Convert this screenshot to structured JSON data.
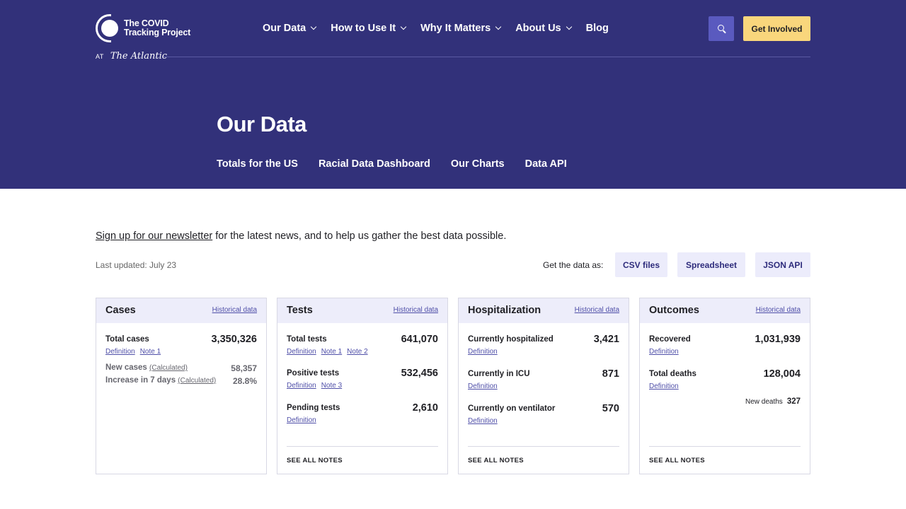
{
  "brand": {
    "name_line1": "The COVID",
    "name_line2": "Tracking Project",
    "at": "AT",
    "partner": "The Atlantic"
  },
  "nav": {
    "items": [
      {
        "label": "Our Data",
        "dropdown": true
      },
      {
        "label": "How to Use It",
        "dropdown": true
      },
      {
        "label": "Why It Matters",
        "dropdown": true
      },
      {
        "label": "About Us",
        "dropdown": true
      },
      {
        "label": "Blog",
        "dropdown": false
      }
    ],
    "search_icon": "search-icon",
    "cta_label": "Get Involved"
  },
  "hero": {
    "title": "Our Data",
    "subnav": [
      "Totals for the US",
      "Racial Data Dashboard",
      "Our Charts",
      "Data API"
    ]
  },
  "intro": {
    "newsletter_link": "Sign up for our newsletter",
    "newsletter_rest": " for the latest news, and to help us gather the best data possible.",
    "last_updated": "Last updated: July 23",
    "get_data_label": "Get the data as:",
    "download_buttons": [
      "CSV files",
      "Spreadsheet",
      "JSON API"
    ]
  },
  "cards": {
    "historical_label": "Historical data",
    "see_all_notes": "SEE ALL NOTES",
    "cases": {
      "title": "Cases",
      "total_label": "Total cases",
      "total_value": "3,350,326",
      "total_links": [
        "Definition",
        "Note 1"
      ],
      "new_label": "New cases",
      "new_calc": "(Calculated)",
      "new_value": "58,357",
      "increase_label": "Increase in 7 days",
      "increase_calc": "(Calculated)",
      "increase_value": "28.8%"
    },
    "tests": {
      "title": "Tests",
      "rows": [
        {
          "label": "Total tests",
          "value": "641,070",
          "links": [
            "Definition",
            "Note 1",
            "Note 2"
          ]
        },
        {
          "label": "Positive tests",
          "value": "532,456",
          "links": [
            "Definition",
            "Note 3"
          ]
        },
        {
          "label": "Pending tests",
          "value": "2,610",
          "links": [
            "Definition"
          ]
        }
      ]
    },
    "hospitalization": {
      "title": "Hospitalization",
      "rows": [
        {
          "label": "Currently hospitalized",
          "value": "3,421",
          "links": [
            "Definition"
          ]
        },
        {
          "label": "Currently in ICU",
          "value": "871",
          "links": [
            "Definition"
          ]
        },
        {
          "label": "Currently on ventilator",
          "value": "570",
          "links": [
            "Definition"
          ]
        }
      ]
    },
    "outcomes": {
      "title": "Outcomes",
      "rows": [
        {
          "label": "Recovered",
          "value": "1,031,939",
          "links": [
            "Definition"
          ]
        },
        {
          "label": "Total deaths",
          "value": "128,004",
          "links": [
            "Definition"
          ]
        }
      ],
      "new_deaths_label": "New deaths",
      "new_deaths_value": "327"
    }
  },
  "colors": {
    "hero_bg": "#32317a",
    "cta_bg": "#f9d67c",
    "search_bg": "#5a5abf",
    "card_head_bg": "#ededfa",
    "link": "#4f4fa8"
  }
}
